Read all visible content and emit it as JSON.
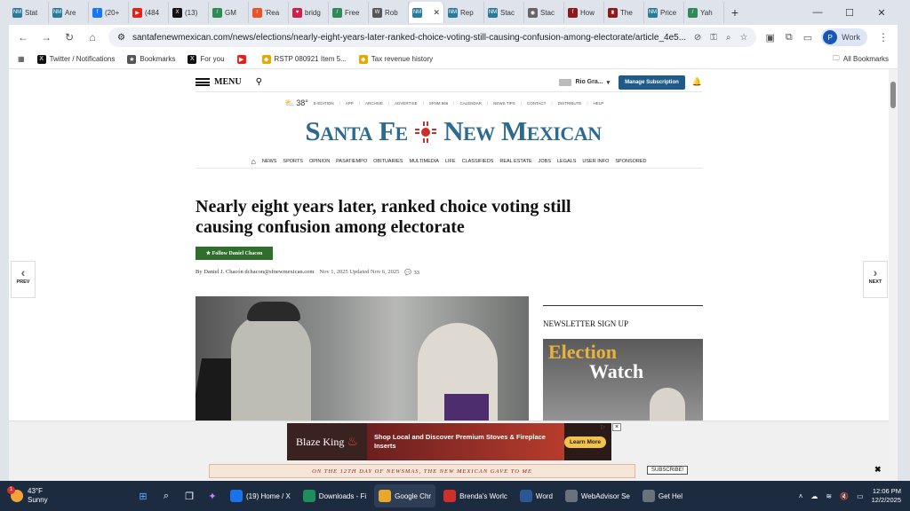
{
  "browser": {
    "tabs": [
      {
        "label": "Stat",
        "fav": "NM",
        "color": "#2a7a9a"
      },
      {
        "label": "Are",
        "fav": "NM",
        "color": "#2a7a9a"
      },
      {
        "label": "(20+",
        "fav": "f",
        "color": "#1877f2"
      },
      {
        "label": "(484",
        "fav": "▶",
        "color": "#e62117"
      },
      {
        "label": "(13)",
        "fav": "X",
        "color": "#111111"
      },
      {
        "label": "GM",
        "fav": "/",
        "color": "#2e8b57"
      },
      {
        "label": "'Rea",
        "fav": "r",
        "color": "#e8552d"
      },
      {
        "label": "bridg",
        "fav": "♥",
        "color": "#d0204a"
      },
      {
        "label": "Free",
        "fav": "/",
        "color": "#2e8b57"
      },
      {
        "label": "Rob",
        "fav": "W",
        "color": "#555555"
      },
      {
        "label": "",
        "fav": "NM",
        "color": "#2a7a9a",
        "active": true
      },
      {
        "label": "Rep",
        "fav": "NM",
        "color": "#2a7a9a"
      },
      {
        "label": "Stac",
        "fav": "NM",
        "color": "#2a7a9a"
      },
      {
        "label": "Stac",
        "fav": "◉",
        "color": "#666666"
      },
      {
        "label": "How",
        "fav": "f",
        "color": "#8b1a1a"
      },
      {
        "label": "The",
        "fav": "♜",
        "color": "#8b1a1a"
      },
      {
        "label": "Price",
        "fav": "NM",
        "color": "#2a7a9a"
      },
      {
        "label": "Yah",
        "fav": "/",
        "color": "#2e8b57"
      }
    ],
    "url": "santafenewmexican.com/news/elections/nearly-eight-years-later-ranked-choice-voting-still-causing-confusion-among-electorate/article_4e5...",
    "profile_initial": "P",
    "profile_label": "Work",
    "bookmarks": [
      {
        "label": "Twitter / Notifications",
        "icon": "X",
        "color": "#111111"
      },
      {
        "label": "Bookmarks",
        "icon": "★",
        "color": "#555555"
      },
      {
        "label": "For you",
        "icon": "X",
        "color": "#111111"
      },
      {
        "label": "",
        "icon": "▶",
        "color": "#e62117"
      },
      {
        "label": "RSTP 080921 Item 5...",
        "icon": "◆",
        "color": "#e6a800"
      },
      {
        "label": "Tax revenue history",
        "icon": "◆",
        "color": "#e6a800"
      }
    ],
    "all_bookmarks": "All Bookmarks"
  },
  "site": {
    "menu_label": "MENU",
    "user_label": "Rio Gra...",
    "manage_subscription": "Manage Subscription",
    "temperature": "38°",
    "util_links": [
      "E-EDITION",
      "APP",
      "ARCHIVE",
      "ADVERTISE",
      "SFNM 966",
      "CALENDAR",
      "NEWS TIPS",
      "CONTACT",
      "DISTRIBUTE",
      "HELP"
    ],
    "masthead_left": "Santa Fe",
    "masthead_right": "New Mexican",
    "sections": [
      "NEWS",
      "SPORTS",
      "OPINION",
      "PASATIEMPO",
      "OBITUARIES",
      "MULTIMEDIA",
      "LIFE",
      "CLASSIFIEDS",
      "REAL ESTATE",
      "JOBS",
      "LEGALS",
      "USER INFO",
      "SPONSORED"
    ],
    "prev": "PREV",
    "next": "NEXT"
  },
  "article": {
    "headline": "Nearly eight years later, ranked choice voting still causing confusion among electorate",
    "follow": "Follow Daniel Chacon",
    "byline": "By Daniel J. Chacón dchacon@sfnewmexican.com",
    "dates": "Nov 1, 2025 Updated Nov 6, 2025",
    "comments": "33"
  },
  "sidebar": {
    "newsletter_title": "NEWSLETTER SIGN UP",
    "promo_word1": "Election",
    "promo_word2": "Watch"
  },
  "ad": {
    "brand": "Blaze King",
    "text": "Shop Local and Discover Premium Stoves & Fireplace Inserts",
    "cta": "Learn More",
    "promo_text": "ON THE 12TH DAY OF NEWSMAS, THE NEW MEXICAN GAVE TO ME",
    "subscribe": "SUBSCRIBE!"
  },
  "taskbar": {
    "temp": "43°F",
    "condition": "Sunny",
    "weather_badge": "1",
    "apps": [
      {
        "label": "(19) Home / X",
        "color": "#1a73e8"
      },
      {
        "label": "Downloads - Fi",
        "color": "#1e8e5a"
      },
      {
        "label": "Google Chr",
        "color": "#e8a82e",
        "active": true
      },
      {
        "label": "Brenda's Worlc",
        "color": "#d0302c"
      },
      {
        "label": "Word",
        "color": "#2b5797"
      },
      {
        "label": "WebAdvisor Se",
        "color": "#6a737d"
      },
      {
        "label": "Get Hel",
        "color": "#6a737d"
      }
    ],
    "time": "12:06 PM",
    "date": "12/2/2025"
  }
}
